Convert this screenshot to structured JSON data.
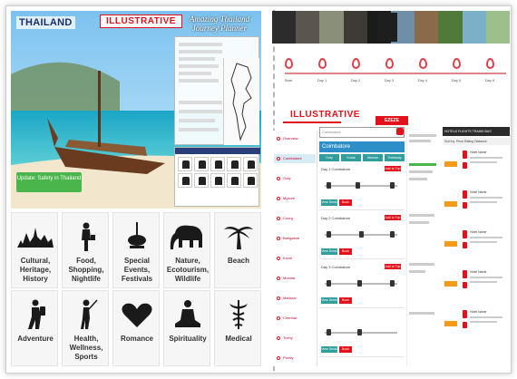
{
  "left": {
    "logo": "THAILAND",
    "watermark": "ILLUSTRATIVE",
    "journey_title": "Amazing Thailand Journey Planner",
    "safety_button": "Update: Safety in Thailand",
    "categories": [
      {
        "label": "Cultural, Heritage, History",
        "icon": "skyline-icon"
      },
      {
        "label": "Food, Shopping, Nightlife",
        "icon": "shopper-icon"
      },
      {
        "label": "Special Events, Festivals",
        "icon": "lantern-icon"
      },
      {
        "label": "Nature, Ecotourism, Wildlife",
        "icon": "elephant-icon"
      },
      {
        "label": "Beach",
        "icon": "palm-tree-icon"
      },
      {
        "label": "Adventure",
        "icon": "hiker-icon"
      },
      {
        "label": "Health, Wellness, Sports",
        "icon": "golfer-icon"
      },
      {
        "label": "Romance",
        "icon": "heart-icon"
      },
      {
        "label": "Spirituality",
        "icon": "buddha-icon"
      },
      {
        "label": "Medical",
        "icon": "caduceus-icon"
      }
    ]
  },
  "right": {
    "watermark": "ILLUSTRATIVE",
    "brand": "EZEZE",
    "city": "Coimbatore",
    "search_placeholder": "Coimbatore",
    "tabs": [
      "Ooty",
      "Kodai",
      "Munnar",
      "Thekkady"
    ],
    "add_button": "Add to Trip",
    "save_button": "Save",
    "green_button": "View Detail",
    "red_button": "Book",
    "entries": [
      "Day 1 Coimbatore",
      "Day 2 Coimbatore",
      "Day 3 Coimbatore"
    ],
    "sidebar_items": [
      "Overview",
      "Coimbatore",
      "Ooty",
      "Mysore",
      "Coorg",
      "Bangalore",
      "Kochi",
      "Munnar",
      "Madurai",
      "Chennai",
      "Trichy",
      "Pondy"
    ],
    "timeline_stops": [
      "Start",
      "Day 1",
      "Day 2",
      "Day 3",
      "Day 4",
      "Day 5",
      "Day 6"
    ],
    "hotel_header": "HOTELS  FLIGHTS  TRAINS  BUS",
    "hotel_subheader": "Sort by: Price  Rating  Distance",
    "hotel_name": "Hotel Name"
  },
  "colors": {
    "accent_red": "#e3111a",
    "teal": "#2f9e9c",
    "blue": "#2d8fc7",
    "green": "#4ab54b",
    "orange": "#f39a1b"
  }
}
